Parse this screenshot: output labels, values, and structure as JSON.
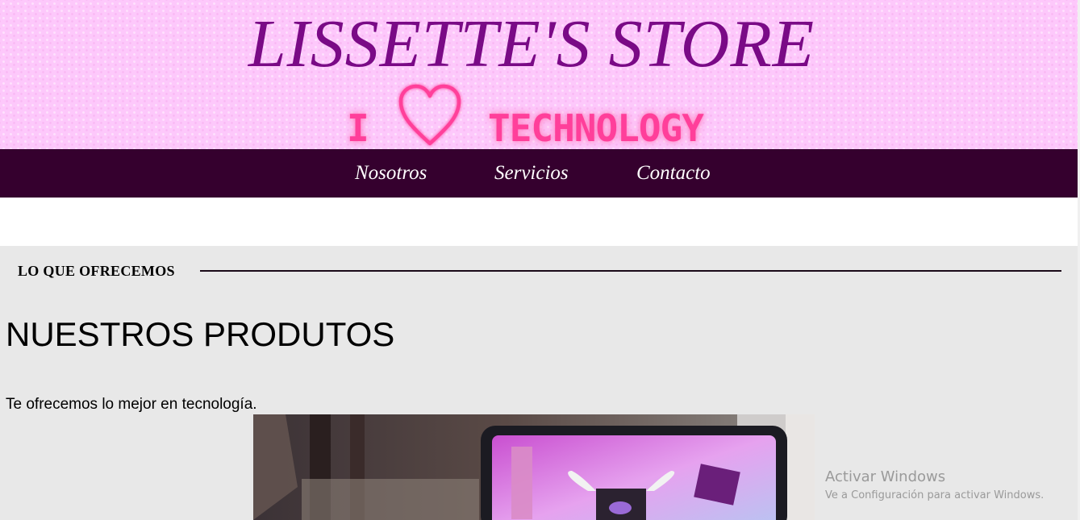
{
  "header": {
    "title": "LISSETTE'S STORE",
    "neon_left": "I",
    "neon_right": "TECHNOLOGY",
    "heart_icon": "heart-outline-icon",
    "background_color": "#fdc8fb",
    "title_color": "#7a0a86",
    "neon_color": "#ff3f9a"
  },
  "nav": {
    "background_color": "#35002e",
    "items": [
      {
        "label": "Nosotros"
      },
      {
        "label": "Servicios"
      },
      {
        "label": "Contacto"
      }
    ]
  },
  "section": {
    "label": "LO QUE OFRECEMOS",
    "heading": "NUESTROS PRODUTOS",
    "intro": "Te ofrecemos lo mejor en tecnología."
  },
  "watermark": {
    "title": "Activar Windows",
    "subtitle": "Ve a Configuración para activar Windows."
  }
}
